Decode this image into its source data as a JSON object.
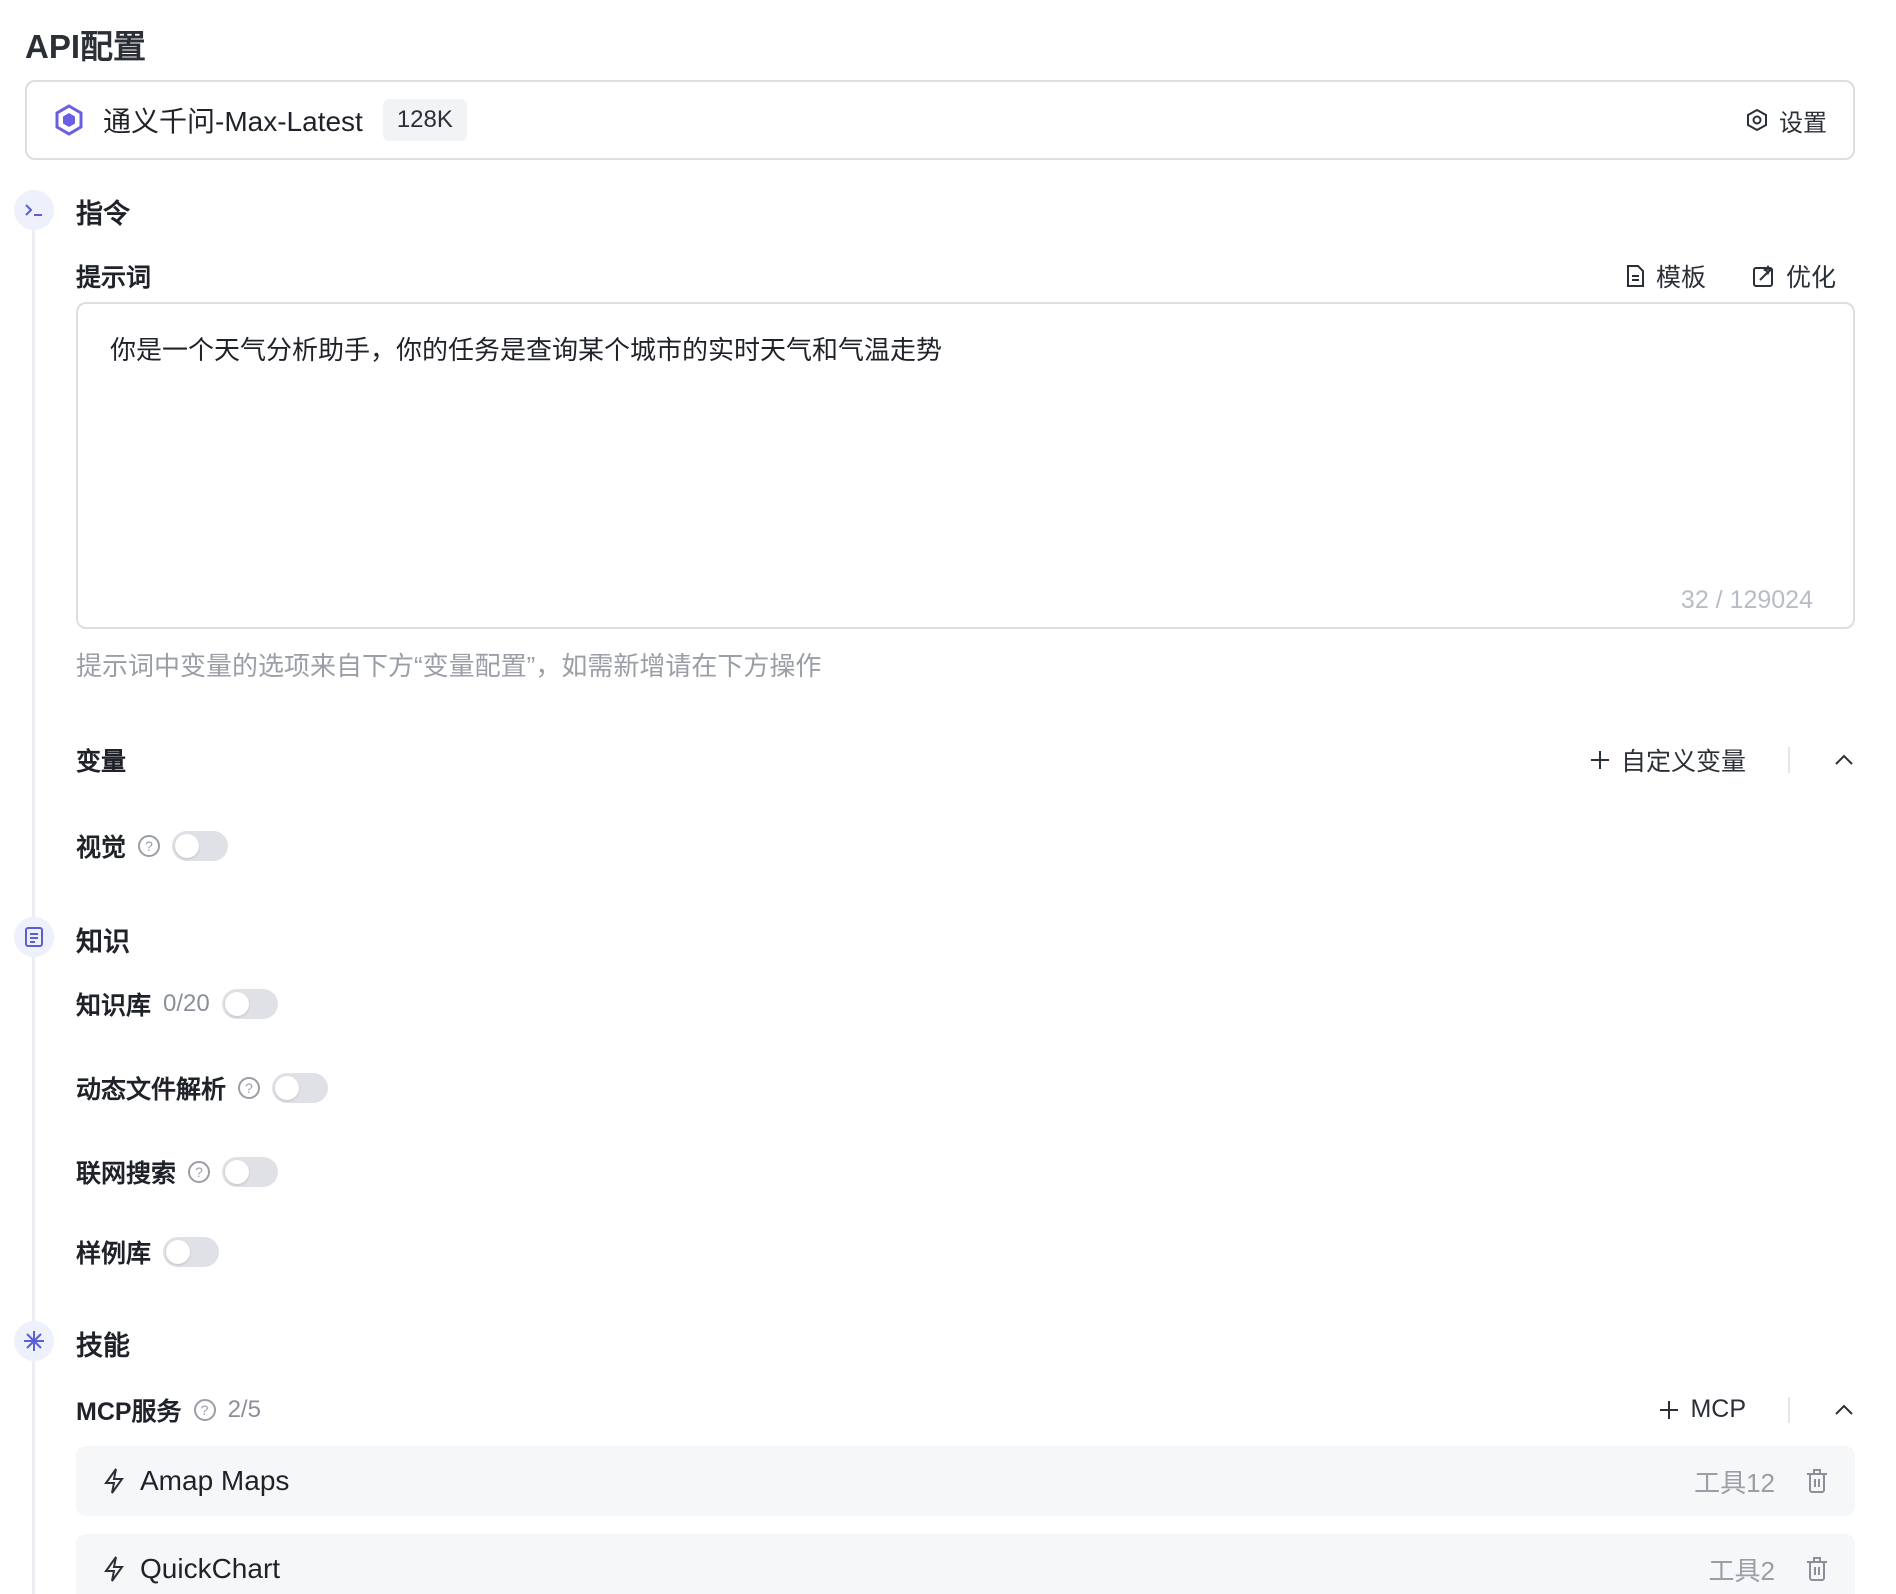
{
  "page": {
    "title": "API配置"
  },
  "model": {
    "name": "通义千问-Max-Latest",
    "context": "128K",
    "settings_label": "设置"
  },
  "instructions": {
    "title": "指令",
    "prompt_label": "提示词",
    "template_label": "模板",
    "optimize_label": "优化",
    "prompt_text": "你是一个天气分析助手，你的任务是查询某个城市的实时天气和气温走势",
    "char_count": "32 / 129024",
    "hint": "提示词中变量的选项来自下方“变量配置”，如需新增请在下方操作",
    "variables_label": "变量",
    "custom_variable_label": "自定义变量",
    "vision_label": "视觉"
  },
  "knowledge": {
    "title": "知识",
    "kb_label": "知识库",
    "kb_count": "0/20",
    "dynamic_file_label": "动态文件解析",
    "web_search_label": "联网搜索",
    "examples_label": "样例库"
  },
  "skills": {
    "title": "技能",
    "mcp_label": "MCP服务",
    "mcp_count": "2/5",
    "add_mcp_label": "MCP",
    "services": [
      {
        "name": "Amap Maps",
        "tools": "工具12"
      },
      {
        "name": "QuickChart",
        "tools": "工具2"
      }
    ]
  },
  "toggles": {
    "vision": false,
    "knowledge_base": false,
    "dynamic_file": false,
    "web_search": false,
    "examples": false
  },
  "colors": {
    "accent": "#5b5fd6",
    "border": "#dcdee3",
    "muted": "#9a9ea6"
  }
}
